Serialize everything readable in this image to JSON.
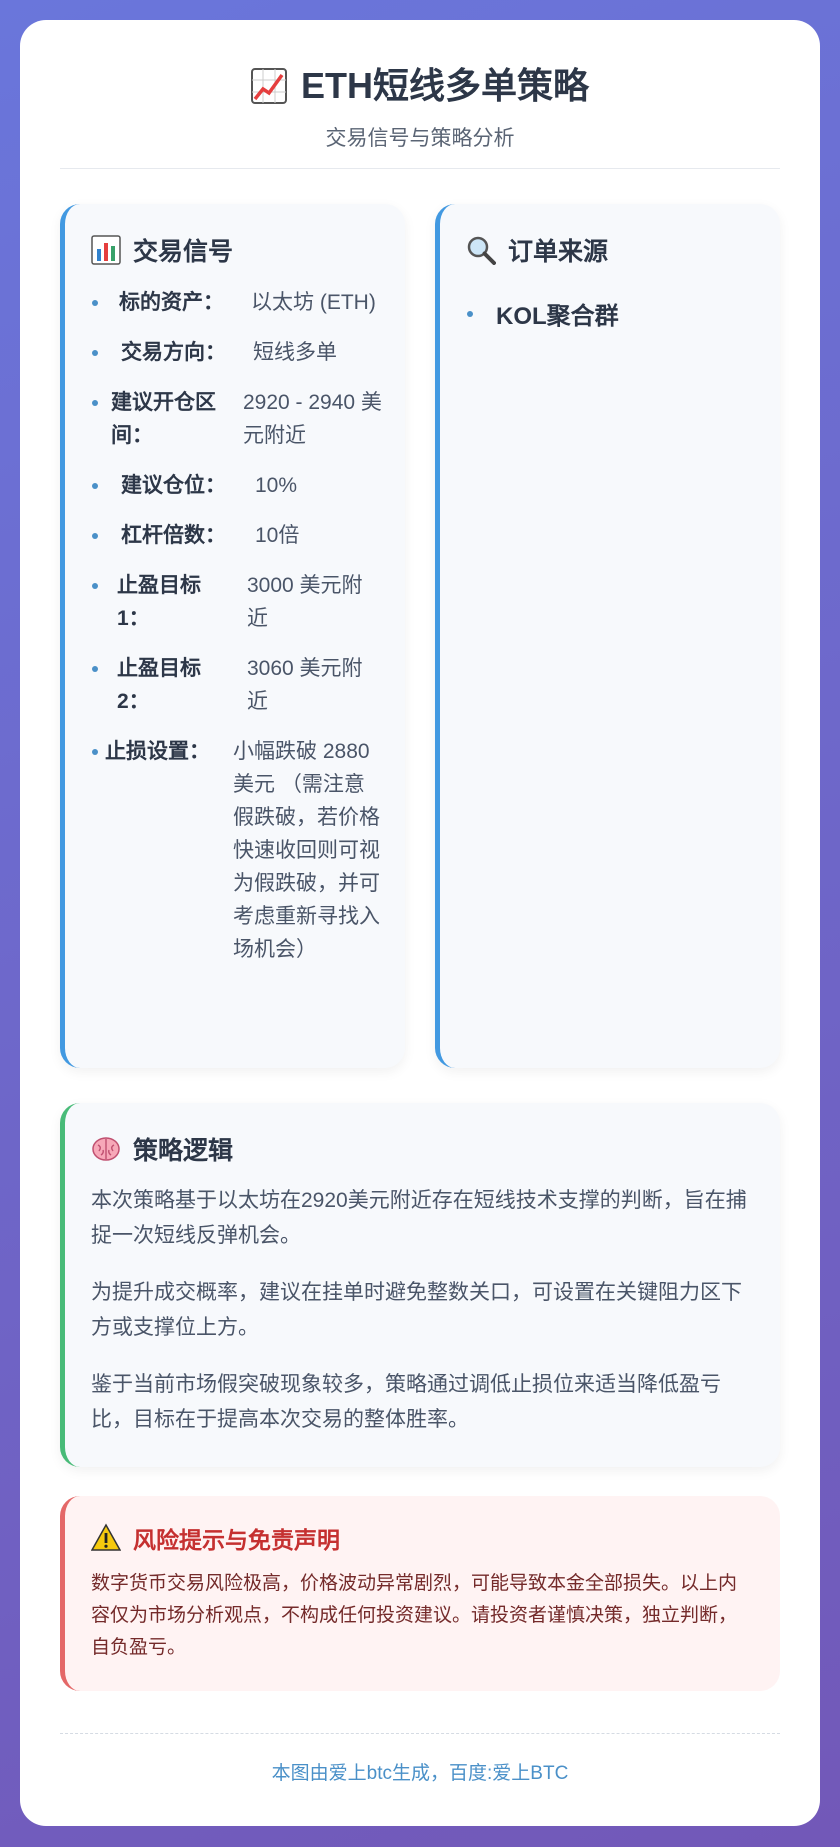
{
  "header": {
    "title": "ETH短线多单策略",
    "subtitle": "交易信号与策略分析",
    "icon": "chart-increasing-icon"
  },
  "signals": {
    "title": "交易信号",
    "icon": "bar-chart-icon",
    "items": [
      {
        "label": "标的资产：",
        "value": "以太坊 (ETH)"
      },
      {
        "label": "交易方向：",
        "value": "短线多单"
      },
      {
        "label": "建议开仓区间：",
        "value": "2920 - 2940 美元附近"
      },
      {
        "label": "建议仓位：",
        "value": "10%"
      },
      {
        "label": "杠杆倍数：",
        "value": "10倍"
      },
      {
        "label": "止盈目标1：",
        "value": "3000 美元附近"
      },
      {
        "label": "止盈目标2：",
        "value": "3060 美元附近"
      },
      {
        "label": "止损设置：",
        "value": "小幅跌破 2880美元 （需注意假跌破，若价格快速收回则可视为假跌破，并可考虑重新寻找入场机会）"
      }
    ]
  },
  "source": {
    "title": "订单来源",
    "icon": "magnifier-icon",
    "items": [
      "KOL聚合群"
    ]
  },
  "logic": {
    "title": "策略逻辑",
    "icon": "brain-icon",
    "paragraphs": [
      "本次策略基于以太坊在2920美元附近存在短线技术支撑的判断，旨在捕捉一次短线反弹机会。",
      "为提升成交概率，建议在挂单时避免整数关口，可设置在关键阻力区下方或支撑位上方。",
      "鉴于当前市场假突破现象较多，策略通过调低止损位来适当降低盈亏比，目标在于提高本次交易的整体胜率。"
    ]
  },
  "risk": {
    "title": "风险提示与免责声明",
    "icon": "warning-icon",
    "text": "数字货币交易风险极高，价格波动异常剧烈，可能导致本金全部损失。以上内容仅为市场分析观点，不构成任何投资建议。请投资者谨慎决策，独立判断，自负盈亏。"
  },
  "footer": {
    "text": "本图由爱上btc生成，百度:爱上BTC"
  },
  "colors": {
    "accent_blue": "#4299e1",
    "accent_green": "#48bb78",
    "risk_red": "#c53030"
  }
}
